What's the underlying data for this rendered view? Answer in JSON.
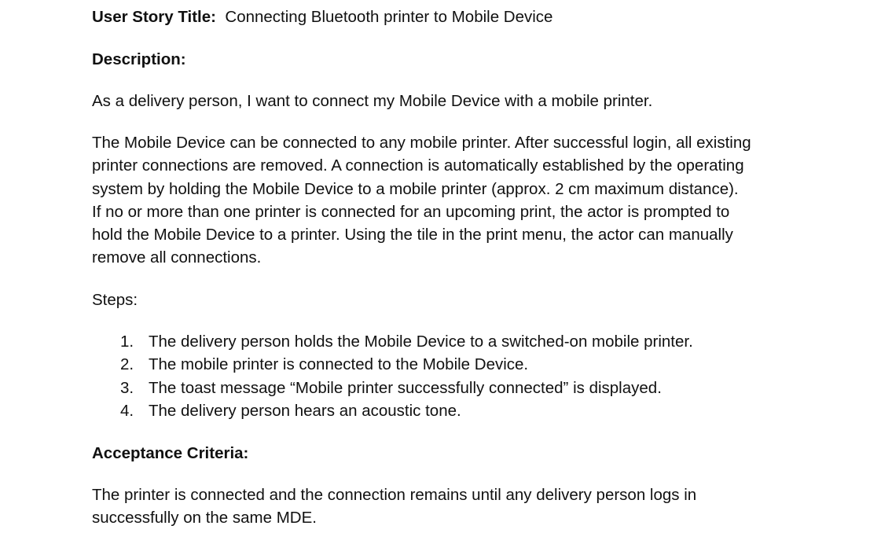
{
  "story": {
    "title_label": "User Story Title:",
    "title_value": "Connecting Bluetooth printer to Mobile Device"
  },
  "description": {
    "heading": "Description:",
    "intro": "As a delivery person, I want to connect my Mobile Device with a mobile printer.",
    "detail_lines": [
      "The Mobile Device can be connected to any mobile printer. After successful login, all existing",
      "printer connections are removed. A connection is automatically established by the operating",
      "system by holding the Mobile Device to a mobile printer (approx. 2 cm maximum distance).",
      "If no or more than one printer is connected for an upcoming print, the actor is prompted to",
      "hold the Mobile Device to a printer. Using the tile in the print menu, the actor can manually",
      "remove all connections."
    ]
  },
  "steps": {
    "heading": "Steps:",
    "items": [
      {
        "number": "1.",
        "text": "The delivery person holds the Mobile Device to a switched-on mobile printer."
      },
      {
        "number": "2.",
        "text": "The mobile printer is connected to the Mobile Device."
      },
      {
        "number": "3.",
        "text": "The toast message “Mobile printer successfully connected” is displayed."
      },
      {
        "number": "4.",
        "text": "The delivery person hears an acoustic tone."
      }
    ]
  },
  "acceptance": {
    "heading": "Acceptance Criteria:",
    "lines": [
      "The printer is connected and the connection remains until any delivery person logs in",
      "successfully on the same MDE."
    ]
  }
}
